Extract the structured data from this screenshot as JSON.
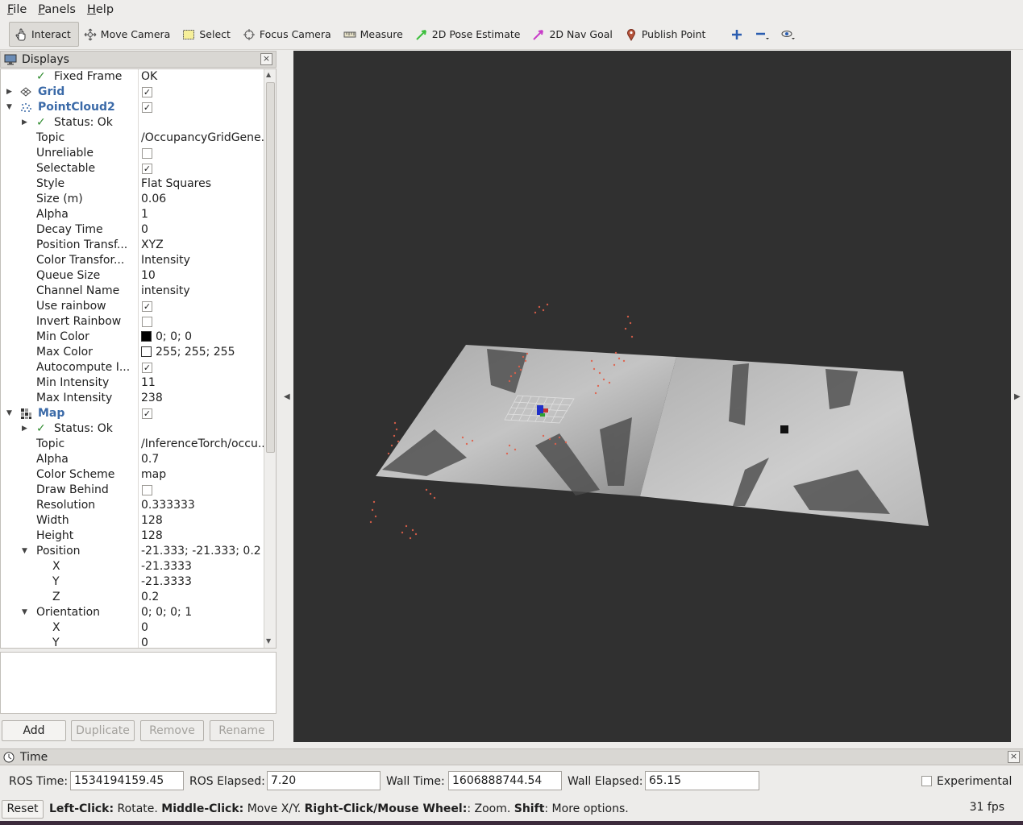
{
  "menu": [
    {
      "u": "F",
      "rest": "ile"
    },
    {
      "u": "P",
      "rest": "anels"
    },
    {
      "u": "H",
      "rest": "elp"
    }
  ],
  "toolbar": {
    "interact": "Interact",
    "move_camera": "Move Camera",
    "select": "Select",
    "focus_camera": "Focus Camera",
    "measure": "Measure",
    "pose_estimate": "2D Pose Estimate",
    "nav_goal": "2D Nav Goal",
    "publish_point": "Publish Point"
  },
  "displays": {
    "title": "Displays",
    "close": "×",
    "fixed_frame": {
      "label": "Fixed Frame",
      "value": "OK"
    },
    "grid": {
      "label": "Grid"
    },
    "pointcloud": {
      "label": "PointCloud2",
      "status": "Status: Ok",
      "topic": {
        "label": "Topic",
        "value": "/OccupancyGridGene..."
      },
      "unreliable": {
        "label": "Unreliable"
      },
      "selectable": {
        "label": "Selectable"
      },
      "style": {
        "label": "Style",
        "value": "Flat Squares"
      },
      "size": {
        "label": "Size (m)",
        "value": "0.06"
      },
      "alpha": {
        "label": "Alpha",
        "value": "1"
      },
      "decay": {
        "label": "Decay Time",
        "value": "0"
      },
      "pos_transform": {
        "label": "Position Transf...",
        "value": "XYZ"
      },
      "color_transform": {
        "label": "Color Transfor...",
        "value": "Intensity"
      },
      "queue": {
        "label": "Queue Size",
        "value": "10"
      },
      "channel": {
        "label": "Channel Name",
        "value": "intensity"
      },
      "use_rainbow": {
        "label": "Use rainbow"
      },
      "invert_rainbow": {
        "label": "Invert Rainbow"
      },
      "min_color": {
        "label": "Min Color",
        "value": "0; 0; 0",
        "color": "#000000"
      },
      "max_color": {
        "label": "Max Color",
        "value": "255; 255; 255",
        "color": "#ffffff"
      },
      "autocompute": {
        "label": "Autocompute I..."
      },
      "min_intensity": {
        "label": "Min Intensity",
        "value": "11"
      },
      "max_intensity": {
        "label": "Max Intensity",
        "value": "238"
      }
    },
    "map": {
      "label": "Map",
      "status": "Status: Ok",
      "topic": {
        "label": "Topic",
        "value": "/InferenceTorch/occu..."
      },
      "alpha": {
        "label": "Alpha",
        "value": "0.7"
      },
      "color_scheme": {
        "label": "Color Scheme",
        "value": "map"
      },
      "draw_behind": {
        "label": "Draw Behind"
      },
      "resolution": {
        "label": "Resolution",
        "value": "0.333333"
      },
      "width": {
        "label": "Width",
        "value": "128"
      },
      "height": {
        "label": "Height",
        "value": "128"
      },
      "position": {
        "label": "Position",
        "value": "-21.333; -21.333; 0.2"
      },
      "pos_x": {
        "label": "X",
        "value": "-21.3333"
      },
      "pos_y": {
        "label": "Y",
        "value": "-21.3333"
      },
      "pos_z": {
        "label": "Z",
        "value": "0.2"
      },
      "orientation": {
        "label": "Orientation",
        "value": "0; 0; 0; 1"
      },
      "ori_x": {
        "label": "X",
        "value": "0"
      },
      "ori_y": {
        "label": "Y",
        "value": "0"
      }
    },
    "check": "✓",
    "buttons": {
      "add": "Add",
      "duplicate": "Duplicate",
      "remove": "Remove",
      "rename": "Rename"
    }
  },
  "time": {
    "title": "Time",
    "close": "×",
    "ros_time_label": "ROS Time:",
    "ros_time": "1534194159.45",
    "ros_elapsed_label": "ROS Elapsed:",
    "ros_elapsed": "7.20",
    "wall_time_label": "Wall Time:",
    "wall_time": "1606888744.54",
    "wall_elapsed_label": "Wall Elapsed:",
    "wall_elapsed": "65.15",
    "experimental": "Experimental"
  },
  "status": {
    "reset": "Reset",
    "h1": "Left-Click:",
    "t1": " Rotate. ",
    "h2": "Middle-Click:",
    "t2": " Move X/Y. ",
    "h3": "Right-Click/Mouse Wheel:",
    "t3": ": Zoom. ",
    "h4": "Shift",
    "t4": ": More options.",
    "fps": "31 fps"
  },
  "colors": {
    "viewport_bg": "#303030",
    "group_label": "#3b6aa8",
    "checkmark": "#2e8b2e",
    "point_cloud": "#e0604a"
  }
}
